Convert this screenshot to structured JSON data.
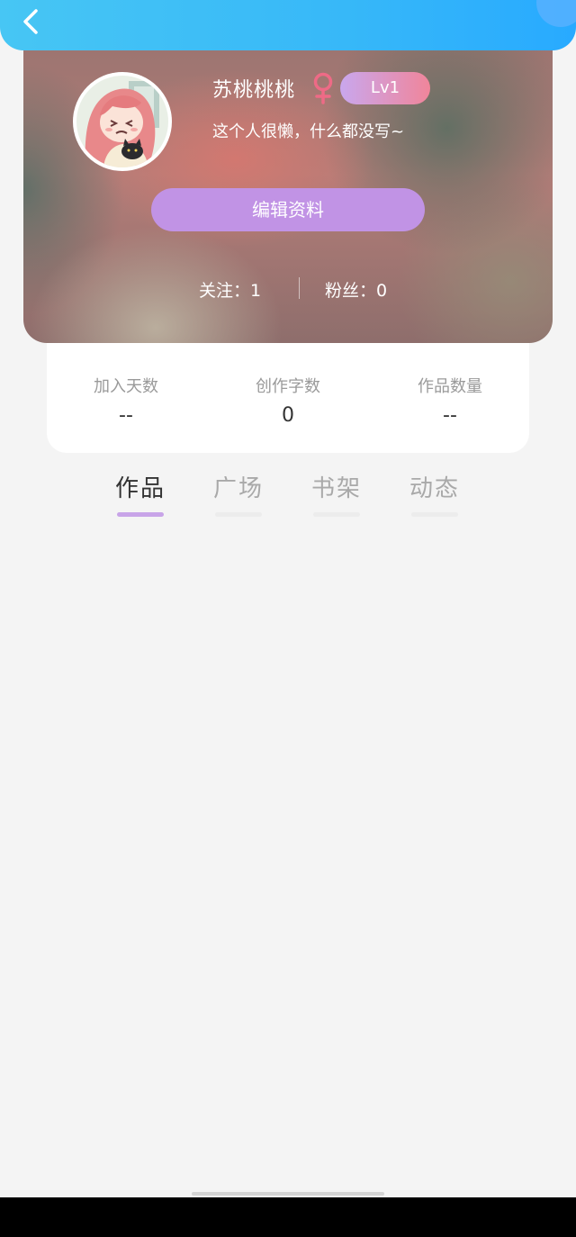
{
  "profile": {
    "username": "苏桃桃桃",
    "gender_icon": "female-icon",
    "level": "Lv1",
    "bio": "这个人很懒，什么都没写~",
    "edit_button": "编辑资料",
    "follow": "关注：1",
    "fans": "粉丝：0"
  },
  "stats": [
    {
      "label": "加入天数",
      "value": "--"
    },
    {
      "label": "创作字数",
      "value": "0"
    },
    {
      "label": "作品数量",
      "value": "--"
    }
  ],
  "tabs": [
    {
      "label": "作品",
      "active": true
    },
    {
      "label": "广场",
      "active": false
    },
    {
      "label": "书架",
      "active": false
    },
    {
      "label": "动态",
      "active": false
    }
  ],
  "colors": {
    "accent": "#c193e5",
    "topbar": "#37b8f8",
    "level_gradient_start": "#c9a7ee",
    "level_gradient_end": "#f0859a",
    "gender_icon": "#ee6a86"
  }
}
